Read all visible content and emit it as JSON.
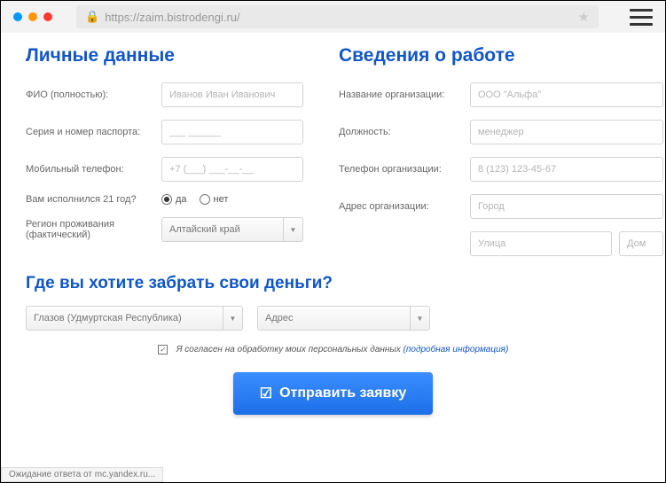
{
  "browser": {
    "url": "https://zaim.bistrodengi.ru/"
  },
  "personal": {
    "title": "Личные данные",
    "fio_label": "ФИО (полностью):",
    "fio_placeholder": "Иванов Иван Иванович",
    "passport_label": "Серия и номер паспорта:",
    "passport_placeholder": "___ ______",
    "phone_label": "Мобильный телефон:",
    "phone_placeholder": "+7 (___) ___-__-__",
    "age_label": "Вам исполнился 21 год?",
    "age_yes": "да",
    "age_no": "нет",
    "region_label": "Регион проживания (фактический)",
    "region_value": "Алтайский край"
  },
  "work": {
    "title": "Сведения о работе",
    "org_label": "Название организации:",
    "org_placeholder": "ООО \"Альфа\"",
    "position_label": "Должность:",
    "position_placeholder": "менеджер",
    "phone_label": "Телефон организации:",
    "phone_placeholder": "8 (123) 123-45-67",
    "address_label": "Адрес организации:",
    "city_placeholder": "Город",
    "street_placeholder": "Улица",
    "house_placeholder": "Дом"
  },
  "pickup": {
    "title": "Где вы хотите забрать свои деньги?",
    "city_value": "Глазов (Удмуртская Республика)",
    "address_value": "Адрес"
  },
  "consent": {
    "text": "Я согласен на обработку моих персональных данных",
    "link": "(подробная информация)"
  },
  "submit": {
    "label": "Отправить заявку"
  },
  "status": {
    "text": "Ожидание ответа от mc.yandex.ru..."
  }
}
